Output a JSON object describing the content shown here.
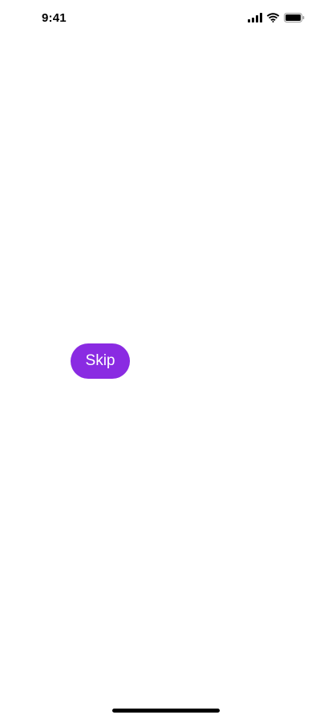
{
  "status_bar": {
    "time": "9:41",
    "icons": [
      "cellular-signal-icon",
      "wifi-icon",
      "battery-icon"
    ]
  },
  "main": {
    "skip_label": "Skip"
  },
  "colors": {
    "accent": "#8a2be2",
    "background": "#ffffff",
    "text": "#000000"
  }
}
